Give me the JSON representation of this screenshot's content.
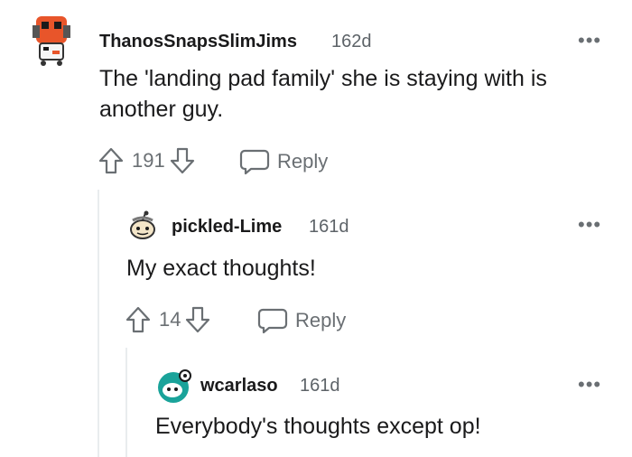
{
  "comments": [
    {
      "username": "ThanosSnapsSlimJims",
      "age": "162d",
      "text": "The 'landing pad family' she is staying with is another guy.",
      "votes": "191",
      "reply_label": "Reply",
      "more_label": "•••"
    },
    {
      "username": "pickled-Lime",
      "age": "161d",
      "text": "My exact thoughts!",
      "votes": "14",
      "reply_label": "Reply",
      "more_label": "•••"
    },
    {
      "username": "wcarlaso",
      "age": "161d",
      "text": "Everybody's thoughts except op!",
      "more_label": "•••"
    }
  ],
  "colors": {
    "text": "#1a1a1b",
    "meta": "#6a6f73",
    "thread_line": "#e9ecee",
    "avatar1": "#e8552a",
    "avatar3": "#1aa39a"
  }
}
